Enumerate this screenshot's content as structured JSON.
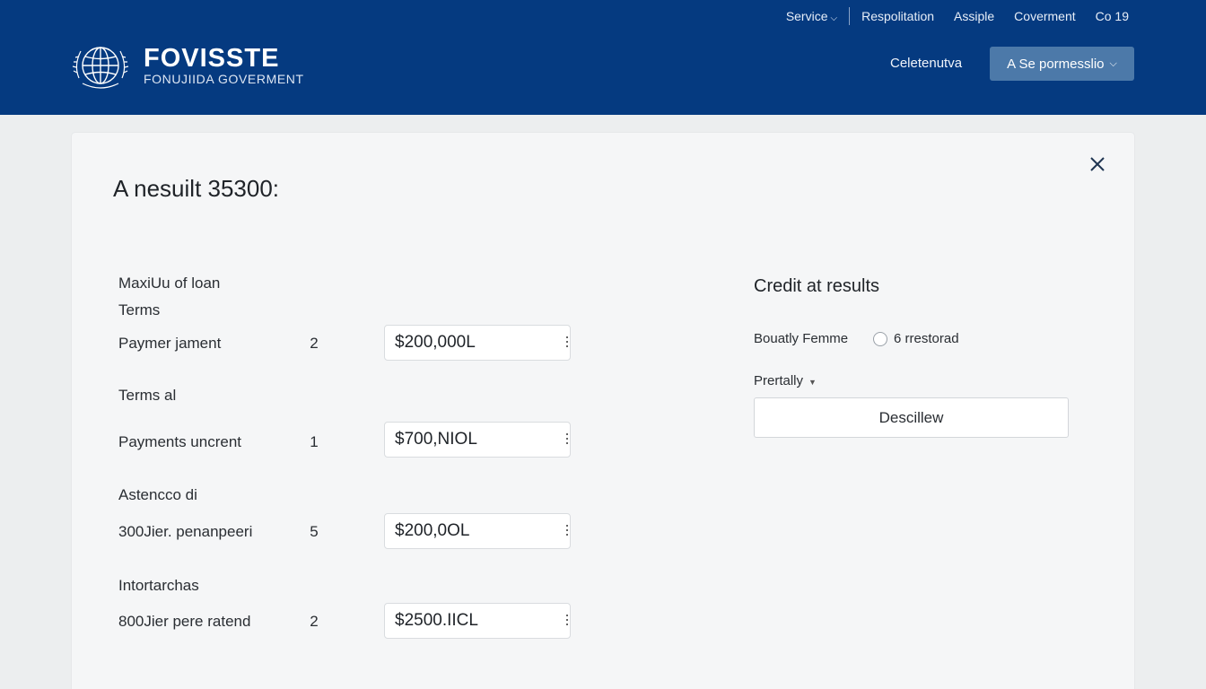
{
  "header": {
    "utility_nav": {
      "service": "Service",
      "respolitation": "Respolitation",
      "assiple": "Assiple",
      "coverment": "Coverment",
      "co19": "Co 19"
    },
    "logo": {
      "name": "FOVISSTE",
      "subtitle": "FONUJIIDA GOVERMENT"
    },
    "link_label": "Celetenutva",
    "button_label": "A Se pormesslio",
    "colors": {
      "background": "#053a80",
      "button": "#4c79a9"
    }
  },
  "card": {
    "title": "A nesuilt 35300:",
    "close_icon": "close-icon",
    "section_label_1a": "MaxiUu of loan",
    "section_label_1b": "Terms",
    "section_label_2": "Terms al",
    "section_label_3": "Astencco di",
    "section_label_4": "Intortarchas",
    "rows": [
      {
        "label": "Paymer jament",
        "count": "2",
        "amount": "$200,000L"
      },
      {
        "label": "Payments uncrent",
        "count": "1",
        "amount": "$700,NIOL"
      },
      {
        "label": "300Jier. penanpeeri",
        "count": "5",
        "amount": "$200,0OL"
      },
      {
        "label": "800Jier pere ratend",
        "count": "2",
        "amount": "$2500.IICL"
      }
    ]
  },
  "right_panel": {
    "title": "Credit at results",
    "field_label": "Bouatly Femme",
    "radio_label": "6 rrestorad",
    "dropdown_label": "Prertally",
    "button_label": "Descillew"
  }
}
